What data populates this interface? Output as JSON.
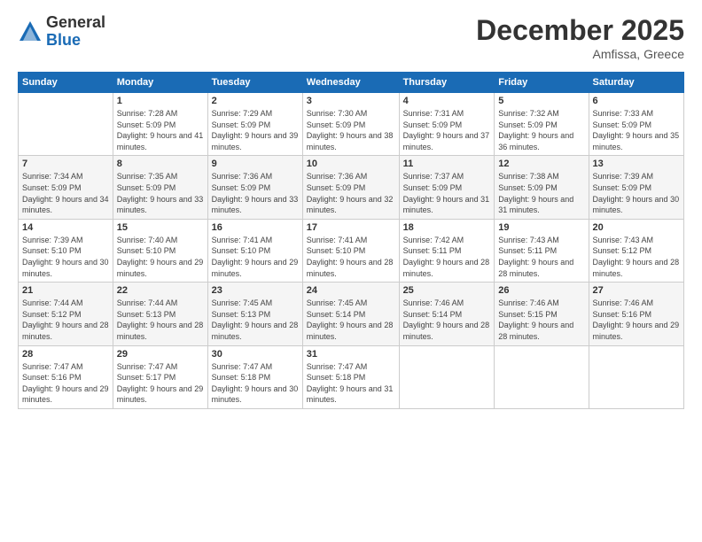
{
  "logo": {
    "general": "General",
    "blue": "Blue"
  },
  "header": {
    "month": "December 2025",
    "location": "Amfissa, Greece"
  },
  "weekdays": [
    "Sunday",
    "Monday",
    "Tuesday",
    "Wednesday",
    "Thursday",
    "Friday",
    "Saturday"
  ],
  "weeks": [
    [
      {
        "day": "",
        "sunrise": "",
        "sunset": "",
        "daylight": ""
      },
      {
        "day": "1",
        "sunrise": "Sunrise: 7:28 AM",
        "sunset": "Sunset: 5:09 PM",
        "daylight": "Daylight: 9 hours and 41 minutes."
      },
      {
        "day": "2",
        "sunrise": "Sunrise: 7:29 AM",
        "sunset": "Sunset: 5:09 PM",
        "daylight": "Daylight: 9 hours and 39 minutes."
      },
      {
        "day": "3",
        "sunrise": "Sunrise: 7:30 AM",
        "sunset": "Sunset: 5:09 PM",
        "daylight": "Daylight: 9 hours and 38 minutes."
      },
      {
        "day": "4",
        "sunrise": "Sunrise: 7:31 AM",
        "sunset": "Sunset: 5:09 PM",
        "daylight": "Daylight: 9 hours and 37 minutes."
      },
      {
        "day": "5",
        "sunrise": "Sunrise: 7:32 AM",
        "sunset": "Sunset: 5:09 PM",
        "daylight": "Daylight: 9 hours and 36 minutes."
      },
      {
        "day": "6",
        "sunrise": "Sunrise: 7:33 AM",
        "sunset": "Sunset: 5:09 PM",
        "daylight": "Daylight: 9 hours and 35 minutes."
      }
    ],
    [
      {
        "day": "7",
        "sunrise": "Sunrise: 7:34 AM",
        "sunset": "Sunset: 5:09 PM",
        "daylight": "Daylight: 9 hours and 34 minutes."
      },
      {
        "day": "8",
        "sunrise": "Sunrise: 7:35 AM",
        "sunset": "Sunset: 5:09 PM",
        "daylight": "Daylight: 9 hours and 33 minutes."
      },
      {
        "day": "9",
        "sunrise": "Sunrise: 7:36 AM",
        "sunset": "Sunset: 5:09 PM",
        "daylight": "Daylight: 9 hours and 33 minutes."
      },
      {
        "day": "10",
        "sunrise": "Sunrise: 7:36 AM",
        "sunset": "Sunset: 5:09 PM",
        "daylight": "Daylight: 9 hours and 32 minutes."
      },
      {
        "day": "11",
        "sunrise": "Sunrise: 7:37 AM",
        "sunset": "Sunset: 5:09 PM",
        "daylight": "Daylight: 9 hours and 31 minutes."
      },
      {
        "day": "12",
        "sunrise": "Sunrise: 7:38 AM",
        "sunset": "Sunset: 5:09 PM",
        "daylight": "Daylight: 9 hours and 31 minutes."
      },
      {
        "day": "13",
        "sunrise": "Sunrise: 7:39 AM",
        "sunset": "Sunset: 5:09 PM",
        "daylight": "Daylight: 9 hours and 30 minutes."
      }
    ],
    [
      {
        "day": "14",
        "sunrise": "Sunrise: 7:39 AM",
        "sunset": "Sunset: 5:10 PM",
        "daylight": "Daylight: 9 hours and 30 minutes."
      },
      {
        "day": "15",
        "sunrise": "Sunrise: 7:40 AM",
        "sunset": "Sunset: 5:10 PM",
        "daylight": "Daylight: 9 hours and 29 minutes."
      },
      {
        "day": "16",
        "sunrise": "Sunrise: 7:41 AM",
        "sunset": "Sunset: 5:10 PM",
        "daylight": "Daylight: 9 hours and 29 minutes."
      },
      {
        "day": "17",
        "sunrise": "Sunrise: 7:41 AM",
        "sunset": "Sunset: 5:10 PM",
        "daylight": "Daylight: 9 hours and 28 minutes."
      },
      {
        "day": "18",
        "sunrise": "Sunrise: 7:42 AM",
        "sunset": "Sunset: 5:11 PM",
        "daylight": "Daylight: 9 hours and 28 minutes."
      },
      {
        "day": "19",
        "sunrise": "Sunrise: 7:43 AM",
        "sunset": "Sunset: 5:11 PM",
        "daylight": "Daylight: 9 hours and 28 minutes."
      },
      {
        "day": "20",
        "sunrise": "Sunrise: 7:43 AM",
        "sunset": "Sunset: 5:12 PM",
        "daylight": "Daylight: 9 hours and 28 minutes."
      }
    ],
    [
      {
        "day": "21",
        "sunrise": "Sunrise: 7:44 AM",
        "sunset": "Sunset: 5:12 PM",
        "daylight": "Daylight: 9 hours and 28 minutes."
      },
      {
        "day": "22",
        "sunrise": "Sunrise: 7:44 AM",
        "sunset": "Sunset: 5:13 PM",
        "daylight": "Daylight: 9 hours and 28 minutes."
      },
      {
        "day": "23",
        "sunrise": "Sunrise: 7:45 AM",
        "sunset": "Sunset: 5:13 PM",
        "daylight": "Daylight: 9 hours and 28 minutes."
      },
      {
        "day": "24",
        "sunrise": "Sunrise: 7:45 AM",
        "sunset": "Sunset: 5:14 PM",
        "daylight": "Daylight: 9 hours and 28 minutes."
      },
      {
        "day": "25",
        "sunrise": "Sunrise: 7:46 AM",
        "sunset": "Sunset: 5:14 PM",
        "daylight": "Daylight: 9 hours and 28 minutes."
      },
      {
        "day": "26",
        "sunrise": "Sunrise: 7:46 AM",
        "sunset": "Sunset: 5:15 PM",
        "daylight": "Daylight: 9 hours and 28 minutes."
      },
      {
        "day": "27",
        "sunrise": "Sunrise: 7:46 AM",
        "sunset": "Sunset: 5:16 PM",
        "daylight": "Daylight: 9 hours and 29 minutes."
      }
    ],
    [
      {
        "day": "28",
        "sunrise": "Sunrise: 7:47 AM",
        "sunset": "Sunset: 5:16 PM",
        "daylight": "Daylight: 9 hours and 29 minutes."
      },
      {
        "day": "29",
        "sunrise": "Sunrise: 7:47 AM",
        "sunset": "Sunset: 5:17 PM",
        "daylight": "Daylight: 9 hours and 29 minutes."
      },
      {
        "day": "30",
        "sunrise": "Sunrise: 7:47 AM",
        "sunset": "Sunset: 5:18 PM",
        "daylight": "Daylight: 9 hours and 30 minutes."
      },
      {
        "day": "31",
        "sunrise": "Sunrise: 7:47 AM",
        "sunset": "Sunset: 5:18 PM",
        "daylight": "Daylight: 9 hours and 31 minutes."
      },
      {
        "day": "",
        "sunrise": "",
        "sunset": "",
        "daylight": ""
      },
      {
        "day": "",
        "sunrise": "",
        "sunset": "",
        "daylight": ""
      },
      {
        "day": "",
        "sunrise": "",
        "sunset": "",
        "daylight": ""
      }
    ]
  ]
}
